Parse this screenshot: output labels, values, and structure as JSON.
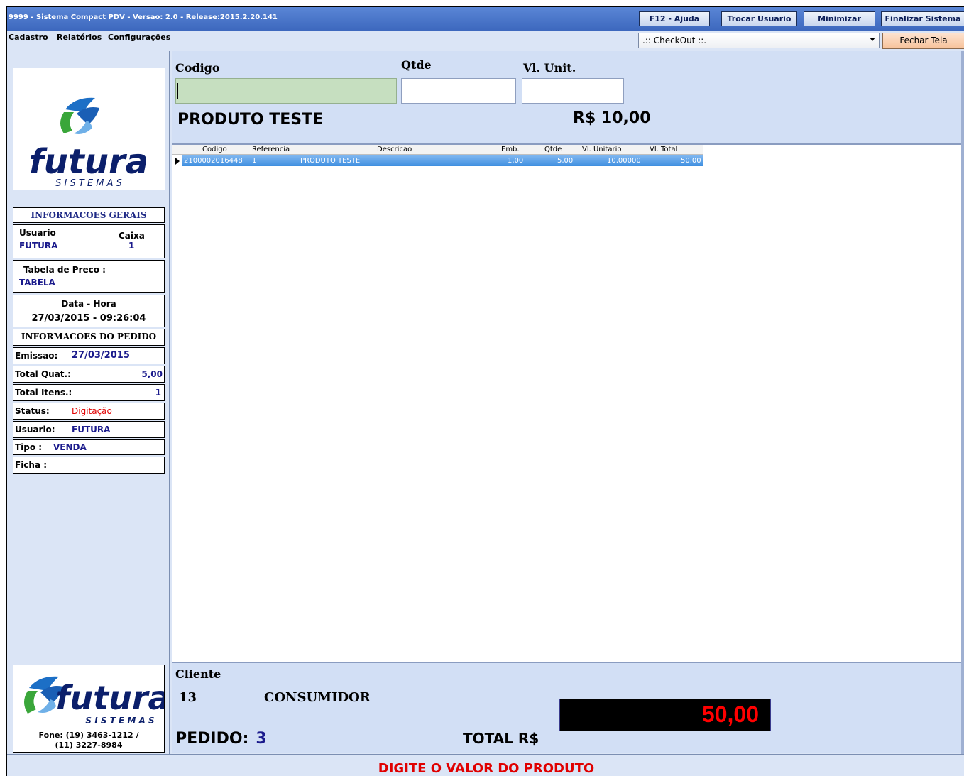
{
  "window": {
    "title": "9999 - Sistema Compact PDV - Versao: 2.0 - Release:2015.2.20.141",
    "buttons": [
      "F12 - Ajuda",
      "Trocar Usuario",
      "Minimizar",
      "Finalizar Sistema"
    ]
  },
  "menu": {
    "items": [
      "Cadastro",
      "Relatórios",
      "Configurações"
    ],
    "combo_value": ".:: CheckOut ::.",
    "close_label": "Fechar Tela"
  },
  "logo": {
    "brand": "futura",
    "sub": "S I S T E M A S"
  },
  "info": {
    "header": "INFORMACOES GERAIS",
    "usuario_label": "Usuario",
    "usuario_value": "FUTURA",
    "caixa_label": "Caixa",
    "caixa_value": "1",
    "tabela_label": "Tabela de Preco :",
    "tabela_value": "TABELA",
    "datahora_label": "Data - Hora",
    "datahora_value": "27/03/2015 - 09:26:04",
    "pedido_header": "INFORMACOES DO PEDIDO",
    "emissao_label": "Emissao:",
    "emissao_value": "27/03/2015",
    "totalquat_label": "Total Quat.:",
    "totalquat_value": "5,00",
    "totalitens_label": "Total Itens.:",
    "totalitens_value": "1",
    "status_label": "Status:",
    "status_value": "Digitação",
    "usuario2_label": "Usuario:",
    "usuario2_value": "FUTURA",
    "tipo_label": "Tipo :",
    "tipo_value": "VENDA",
    "ficha_label": "Ficha :"
  },
  "entry": {
    "codigo_label": "Codigo",
    "qtde_label": "Qtde",
    "vlunit_label": "Vl. Unit.",
    "product_name": "PRODUTO TESTE",
    "product_price": "R$  10,00"
  },
  "grid": {
    "columns": [
      "Codigo",
      "Referencia",
      "Descricao",
      "Emb.",
      "Qtde",
      "Vl. Unitario",
      "Vl. Total"
    ],
    "rows": [
      {
        "codigo": "2100002016448",
        "referencia": "1",
        "descricao": "PRODUTO TESTE",
        "emb": "1,00",
        "qtde": "5,00",
        "vl_unitario": "10,00000",
        "vl_total": "50,00"
      }
    ]
  },
  "footer": {
    "cliente_label": "Cliente",
    "cliente_code": "13",
    "cliente_name": "CONSUMIDOR",
    "pedido_label": "PEDIDO:",
    "pedido_value": "3",
    "total_label": "TOTAL R$",
    "total_value": "50,00",
    "phone_line1": "Fone: (19) 3463-1212 /",
    "phone_line2": "(11) 3227-8984"
  },
  "status_message": "DIGITE O VALOR DO PRODUTO",
  "colors": {
    "accent_red": "#e00000",
    "value_blue": "#1a1a8c",
    "code_field_green": "#c6dfc0"
  }
}
